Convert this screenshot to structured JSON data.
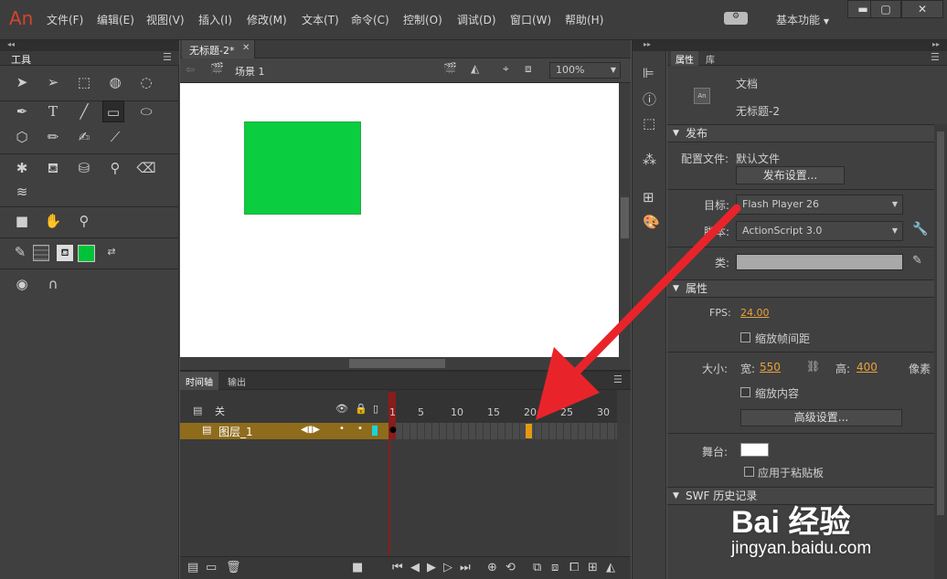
{
  "app": {
    "logo": "An"
  },
  "menu": [
    "文件(F)",
    "编辑(E)",
    "视图(V)",
    "插入(I)",
    "修改(M)",
    "文本(T)",
    "命令(C)",
    "控制(O)",
    "调试(D)",
    "窗口(W)",
    "帮助(H)"
  ],
  "workspace": "基本功能",
  "window_buttons": {
    "minimize": "▬",
    "maximize": "▢",
    "close": "✕"
  },
  "tools_panel": {
    "title": "工具"
  },
  "document": {
    "tab": "无标题-2*",
    "scene": "场景 1",
    "zoom": "100%"
  },
  "stage": {
    "rect_color": "#0bcd40",
    "fill_color": "#00c33a"
  },
  "timeline": {
    "tabs": [
      "时间轴",
      "输出"
    ],
    "folder_layer": "关",
    "layer": "图层_1",
    "ticks": [
      "1",
      "5",
      "10",
      "15",
      "20",
      "25",
      "30"
    ]
  },
  "properties": {
    "tabs": [
      "属性",
      "库"
    ],
    "doc_label": "文档",
    "doc_name": "无标题-2",
    "doc_icon": "An",
    "publish_section": "发布",
    "profile_label": "配置文件:",
    "profile_value": "默认文件",
    "publish_settings_btn": "发布设置...",
    "target_label": "目标:",
    "target_value": "Flash Player 26",
    "script_label": "脚本:",
    "script_value": "ActionScript 3.0",
    "class_label": "类:",
    "props_section": "属性",
    "fps_label": "FPS:",
    "fps_value": "24.00",
    "scale_interval": "缩放帧间距",
    "size_label": "大小:",
    "width_label": "宽:",
    "width_value": "550",
    "height_label": "高:",
    "height_value": "400",
    "unit_label": "像素",
    "scale_content": "缩放内容",
    "advanced_btn": "高级设置...",
    "stage_label": "舞台:",
    "stage_color": "#ffffff",
    "apply_paste": "应用于粘贴板",
    "swf_section": "SWF 历史记录"
  },
  "watermark": {
    "brand": "Bai 经验",
    "url": "jingyan.baidu.com"
  },
  "colors": {
    "accent_arrow": "#e8242a",
    "layer_row": "#8f6c1c",
    "frame_marker": "#e39a12"
  }
}
